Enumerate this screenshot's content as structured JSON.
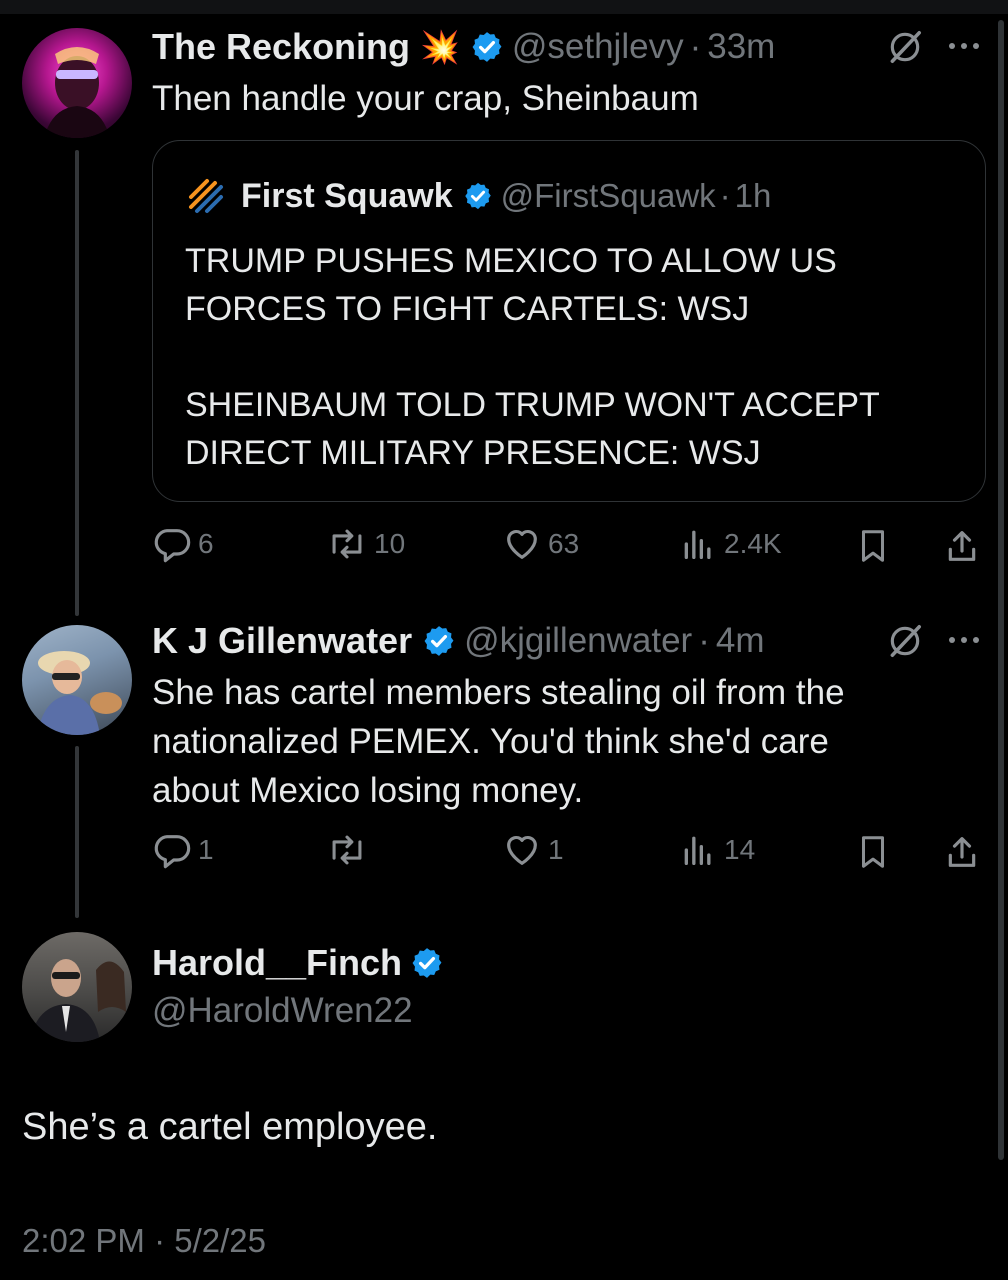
{
  "tweets": [
    {
      "name": "The Reckoning",
      "emoji": "💥",
      "handle": "@sethjlevy",
      "time": "33m",
      "text": "Then handle your crap, Sheinbaum",
      "quote": {
        "name": "First Squawk",
        "handle": "@FirstSquawk",
        "time": "1h",
        "paragraphs": [
          "TRUMP PUSHES MEXICO TO ALLOW US FORCES TO FIGHT CARTELS: WSJ",
          "SHEINBAUM TOLD TRUMP WON'T ACCEPT DIRECT MILITARY PRESENCE: WSJ"
        ]
      },
      "stats": {
        "replies": "6",
        "reposts": "10",
        "likes": "63",
        "views": "2.4K"
      }
    },
    {
      "name": "K J Gillenwater",
      "handle": "@kjgillenwater",
      "time": "4m",
      "text_lines": [
        "She has cartel members stealing oil from the",
        "nationalized PEMEX. You'd think she'd care",
        "about Mexico losing money."
      ],
      "stats": {
        "replies": "1",
        "reposts": "",
        "likes": "1",
        "views": "14"
      }
    }
  ],
  "main": {
    "name": "Harold__Finch",
    "handle": "@HaroldWren22",
    "text": "She’s a cartel employee.",
    "timestamp": "2:02 PM · 5/2/25"
  },
  "dot_separator": "·",
  "colors": {
    "background": "#000000",
    "text": "#e7e9ea",
    "muted": "#71767b",
    "verified": "#1d9bf0",
    "border": "#2f3336"
  },
  "icons": [
    "grok-icon",
    "more-icon",
    "reply-icon",
    "repost-icon",
    "like-icon",
    "views-icon",
    "bookmark-icon",
    "share-icon",
    "verified-badge-icon",
    "first-squawk-logo-icon"
  ]
}
